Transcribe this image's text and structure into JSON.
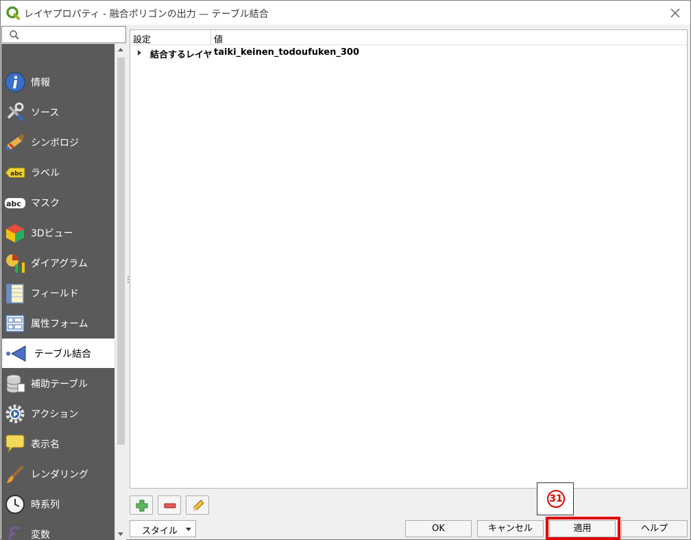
{
  "window": {
    "title": "レイヤプロパティ - 融合ポリゴンの出力 — テーブル結合"
  },
  "sidebar": {
    "search_placeholder": "",
    "items": [
      {
        "label": "情報",
        "icon": "info-icon"
      },
      {
        "label": "ソース",
        "icon": "source-tools-icon"
      },
      {
        "label": "シンボロジ",
        "icon": "symbology-brush-icon"
      },
      {
        "label": "ラベル",
        "icon": "labels-abc-icon"
      },
      {
        "label": "マスク",
        "icon": "mask-abc-icon"
      },
      {
        "label": "3Dビュー",
        "icon": "3d-cube-icon"
      },
      {
        "label": "ダイアグラム",
        "icon": "diagram-icon"
      },
      {
        "label": "フィールド",
        "icon": "fields-icon"
      },
      {
        "label": "属性フォーム",
        "icon": "attribute-form-icon"
      },
      {
        "label": "テーブル結合",
        "icon": "joins-icon"
      },
      {
        "label": "補助テーブル",
        "icon": "auxiliary-storage-icon"
      },
      {
        "label": "アクション",
        "icon": "actions-gear-icon"
      },
      {
        "label": "表示名",
        "icon": "display-speech-bubble-icon"
      },
      {
        "label": "レンダリング",
        "icon": "rendering-brush-icon"
      },
      {
        "label": "時系列",
        "icon": "temporal-clock-icon"
      },
      {
        "label": "変数",
        "icon": "variables-epsilon-icon"
      }
    ],
    "active_index": 9
  },
  "tree": {
    "col_setting": "設定",
    "col_value": "値",
    "rows": [
      {
        "setting": "結合するレイヤ",
        "value": "taiki_keinen_todoufuken_300"
      }
    ]
  },
  "toolbar": {
    "style_label": "スタイル",
    "ok_label": "OK",
    "cancel_label": "キャンセル",
    "apply_label": "適用",
    "help_label": "ヘルプ"
  },
  "annotation": {
    "number": "31"
  },
  "colors": {
    "sidebar_bg": "#5a5a5a",
    "highlight": "#e00000"
  }
}
